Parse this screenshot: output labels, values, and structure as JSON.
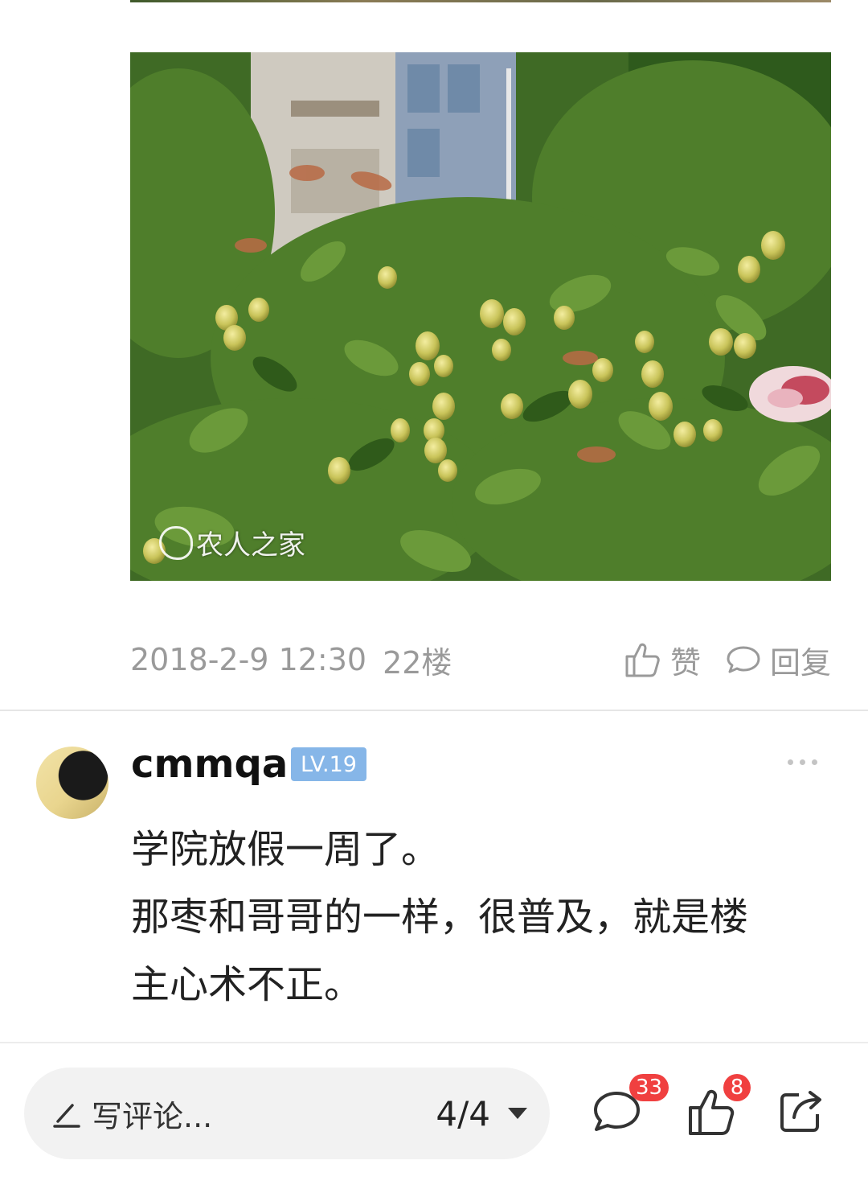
{
  "post": {
    "watermark": "农人之家",
    "date": "2018-2-9 12:30",
    "floor": "22楼",
    "like_label": "赞",
    "reply_label": "回复"
  },
  "reply": {
    "username": "cmmqa",
    "level": "LV.19",
    "lines": [
      "学院放假一周了。",
      "那枣和哥哥的一样，很普及，就是楼",
      "主心术不正。"
    ]
  },
  "bottom_bar": {
    "comment_placeholder": "写评论...",
    "page_indicator": "4/4",
    "comment_count": "33",
    "like_count": "8"
  },
  "colors": {
    "level_badge": "#86b6e8",
    "count_badge": "#f04040",
    "meta_text": "#9a9a9a"
  },
  "icons": [
    "thumbs-up-icon",
    "comment-bubble-icon",
    "pen-icon",
    "chevron-down-icon",
    "share-icon",
    "more-dots-icon"
  ]
}
